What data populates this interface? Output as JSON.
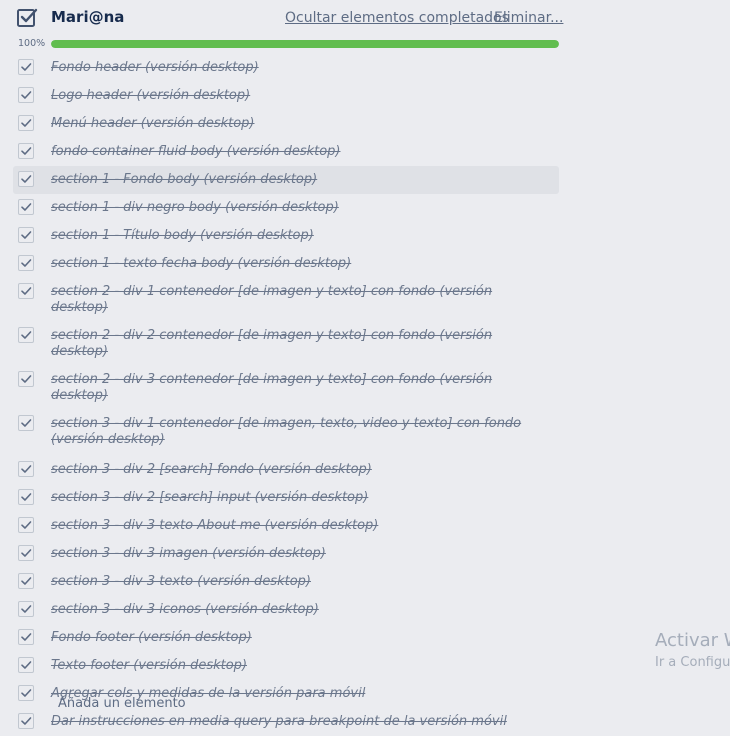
{
  "checklist": {
    "title": "Mari@na",
    "hide_completed_label": "Ocultar elementos completados",
    "delete_label": "Eliminar...",
    "progress_label": "100%",
    "progress_value": 1.0,
    "progress_color": "#61bd4f",
    "items": [
      {
        "label": "Fondo header (versión desktop)"
      },
      {
        "label": "Logo header (versión desktop)"
      },
      {
        "label": "Menú header (versión desktop)"
      },
      {
        "label": "fondo container fluid  body (versión desktop)"
      },
      {
        "label": "section 1 - Fondo body (versión desktop)"
      },
      {
        "label": "section 1 - div negro body (versión desktop)"
      },
      {
        "label": "section 1 - Título body (versión desktop)"
      },
      {
        "label": "section 1 - texto fecha  body (versión desktop)"
      },
      {
        "label": "section 2 - div 1 contenedor [de imagen y texto] con fondo (versión desktop)"
      },
      {
        "label": "section 2 - div 2 contenedor [de imagen y texto] con fondo (versión desktop)"
      },
      {
        "label": "section 2 - div 3 contenedor [de imagen y texto] con fondo (versión desktop)"
      },
      {
        "label": "section 3 - div 1 contenedor [de imagen, texto, video y texto] con fondo (versión desktop)"
      },
      {
        "label": "section 3 - div 2 [search] fondo (versión desktop)"
      },
      {
        "label": "section 3 - div 2 [search] input (versión desktop)"
      },
      {
        "label": "section 3 - div 3 texto About me (versión desktop)"
      },
      {
        "label": "section 3 - div 3 imagen (versión desktop)"
      },
      {
        "label": "section 3 - div 3 texto (versión desktop)"
      },
      {
        "label": "section 3 - div 3 iconos (versión desktop)"
      },
      {
        "label": "Fondo footer (versión desktop)"
      },
      {
        "label": "Texto footer (versión desktop)"
      },
      {
        "label": "Agregar cols y medidas de la versión para móvil"
      },
      {
        "label": "Dar instrucciones en media query para breakpoint de la versión móvil"
      }
    ],
    "add_item_label": "Añada un elemento"
  },
  "watermark": {
    "title": "Activar W",
    "subtitle": "Ir a Configu"
  },
  "icons": {
    "header": "checklist-icon",
    "item_checkbox": "checkmark-icon"
  }
}
